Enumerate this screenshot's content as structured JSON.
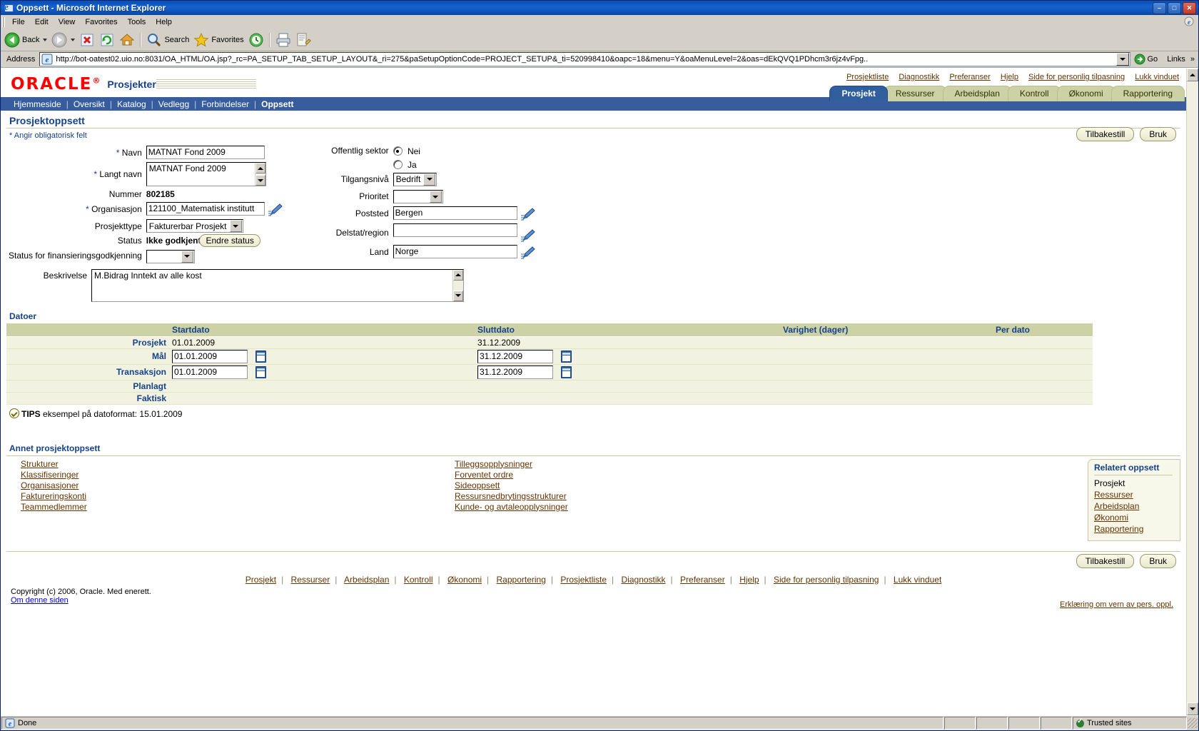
{
  "window": {
    "title": "Oppsett - Microsoft Internet Explorer",
    "icon": "ie-icon",
    "minimize": "–",
    "maximize": "□",
    "close": "✕"
  },
  "menu": {
    "items": [
      "File",
      "Edit",
      "View",
      "Favorites",
      "Tools",
      "Help"
    ]
  },
  "toolbar": {
    "back": "Back",
    "forward": "",
    "stop": "stop-icon",
    "refresh": "refresh-icon",
    "home": "home-icon",
    "search": "Search",
    "favorites": "Favorites",
    "history": "history-icon",
    "print": "print-icon",
    "edit": "edit-icon"
  },
  "address": {
    "label": "Address",
    "url": "http://bot-oatest02.uio.no:8031/OA_HTML/OA.jsp?_rc=PA_SETUP_TAB_SETUP_LAYOUT&_ri=275&paSetupOptionCode=PROJECT_SETUP&_ti=520998410&oapc=18&menu=Y&oaMenuLevel=2&oas=dEkQVQ1PDhcm3r6jz4vFpg..",
    "go": "Go",
    "links": "Links"
  },
  "branding": {
    "logo": "ORACLE",
    "app_name": "Prosjekter"
  },
  "global_links": [
    "Prosjektliste",
    "Diagnostikk",
    "Preferanser",
    "Hjelp",
    "Side for personlig tilpasning",
    "Lukk vinduet"
  ],
  "tabs": [
    {
      "label": "Prosjekt",
      "selected": true
    },
    {
      "label": "Ressurser",
      "selected": false
    },
    {
      "label": "Arbeidsplan",
      "selected": false
    },
    {
      "label": "Kontroll",
      "selected": false
    },
    {
      "label": "Økonomi",
      "selected": false
    },
    {
      "label": "Rapportering",
      "selected": false
    }
  ],
  "subnav": {
    "items": [
      "Hjemmeside",
      "Oversikt",
      "Katalog",
      "Vedlegg",
      "Forbindelser",
      "Oppsett"
    ],
    "current": "Oppsett"
  },
  "page": {
    "title": "Prosjektoppsett",
    "required_note": "Angir obligatorisk felt",
    "required_star": "*"
  },
  "actions": {
    "reset": "Tilbakestill",
    "apply": "Bruk"
  },
  "form_left": {
    "navn_label": "Navn",
    "navn_value": "MATNAT Fond 2009",
    "langt_navn_label": "Langt navn",
    "langt_navn_value": "MATNAT Fond 2009",
    "nummer_label": "Nummer",
    "nummer_value": "802185",
    "organisasjon_label": "Organisasjon",
    "organisasjon_value": "121100_Matematisk institutt",
    "prosjekttype_label": "Prosjekttype",
    "prosjekttype_value": "Fakturerbar Prosjekt",
    "status_label": "Status",
    "status_value": "Ikke godkjent",
    "status_button": "Endre status",
    "finans_label": "Status for finansieringsgodkjenning",
    "finans_value": "",
    "beskrivelse_label": "Beskrivelse",
    "beskrivelse_value": "M.Bidrag Inntekt av alle kost"
  },
  "form_right": {
    "offentlig_label": "Offentlig sektor",
    "offentlig_nei": "Nei",
    "offentlig_ja": "Ja",
    "offentlig_selected": "Nei",
    "tilgang_label": "Tilgangsnivå",
    "tilgang_value": "Bedrift",
    "prioritet_label": "Prioritet",
    "prioritet_value": "",
    "poststed_label": "Poststed",
    "poststed_value": "Bergen",
    "delstat_label": "Delstat/region",
    "delstat_value": "",
    "land_label": "Land",
    "land_value": "Norge"
  },
  "dates": {
    "section_title": "Datoer",
    "columns": [
      "",
      "Startdato",
      "Sluttdato",
      "Varighet (dager)",
      "Per dato"
    ],
    "rows": [
      {
        "label": "Prosjekt",
        "start": "01.01.2009",
        "end": "31.12.2009",
        "varighet": "",
        "perdato": "",
        "editable": false
      },
      {
        "label": "Mål",
        "start": "01.01.2009",
        "end": "31.12.2009",
        "varighet": "",
        "perdato": "",
        "editable": true
      },
      {
        "label": "Transaksjon",
        "start": "01.01.2009",
        "end": "31.12.2009",
        "varighet": "",
        "perdato": "",
        "editable": true
      },
      {
        "label": "Planlagt",
        "start": "",
        "end": "",
        "varighet": "",
        "perdato": "",
        "editable": false
      },
      {
        "label": "Faktisk",
        "start": "",
        "end": "",
        "varighet": "",
        "perdato": "",
        "editable": false
      }
    ],
    "tip_bold": "TIPS",
    "tip_text": "eksempel på datoformat: 15.01.2009"
  },
  "other_setup": {
    "title": "Annet prosjektoppsett",
    "col1": [
      "Strukturer",
      "Klassifiseringer",
      "Organisasjoner",
      "Faktureringskonti",
      "Teammedlemmer"
    ],
    "col2": [
      "Tilleggsopplysninger",
      "Forventet ordre",
      "Sideoppsett",
      "Ressursnedbrytingsstrukturer",
      "Kunde- og avtaleopplysninger"
    ]
  },
  "related": {
    "title": "Relatert oppsett",
    "items": [
      {
        "label": "Prosjekt",
        "link": false
      },
      {
        "label": "Ressurser",
        "link": true
      },
      {
        "label": "Arbeidsplan",
        "link": true
      },
      {
        "label": "Økonomi",
        "link": true
      },
      {
        "label": "Rapportering",
        "link": true
      }
    ]
  },
  "footer": {
    "links": [
      "Prosjekt",
      "Ressurser",
      "Arbeidsplan",
      "Kontroll",
      "Økonomi",
      "Rapportering",
      "Prosjektliste",
      "Diagnostikk",
      "Preferanser",
      "Hjelp",
      "Side for personlig tilpasning",
      "Lukk vinduet"
    ],
    "copyright": "Copyright (c) 2006, Oracle. Med enerett.",
    "about": "Om denne siden",
    "privacy": "Erklæring om vern av pers. oppl."
  },
  "status": {
    "text": "Done",
    "zone": "Trusted sites"
  },
  "colors": {
    "oracle_red": "#ff0000",
    "header_blue": "#15428b",
    "tab_bg": "#ccd1a6",
    "tab_selected": "#315f9e",
    "link_brown": "#663300",
    "title_blue": "#0a4fb5"
  }
}
